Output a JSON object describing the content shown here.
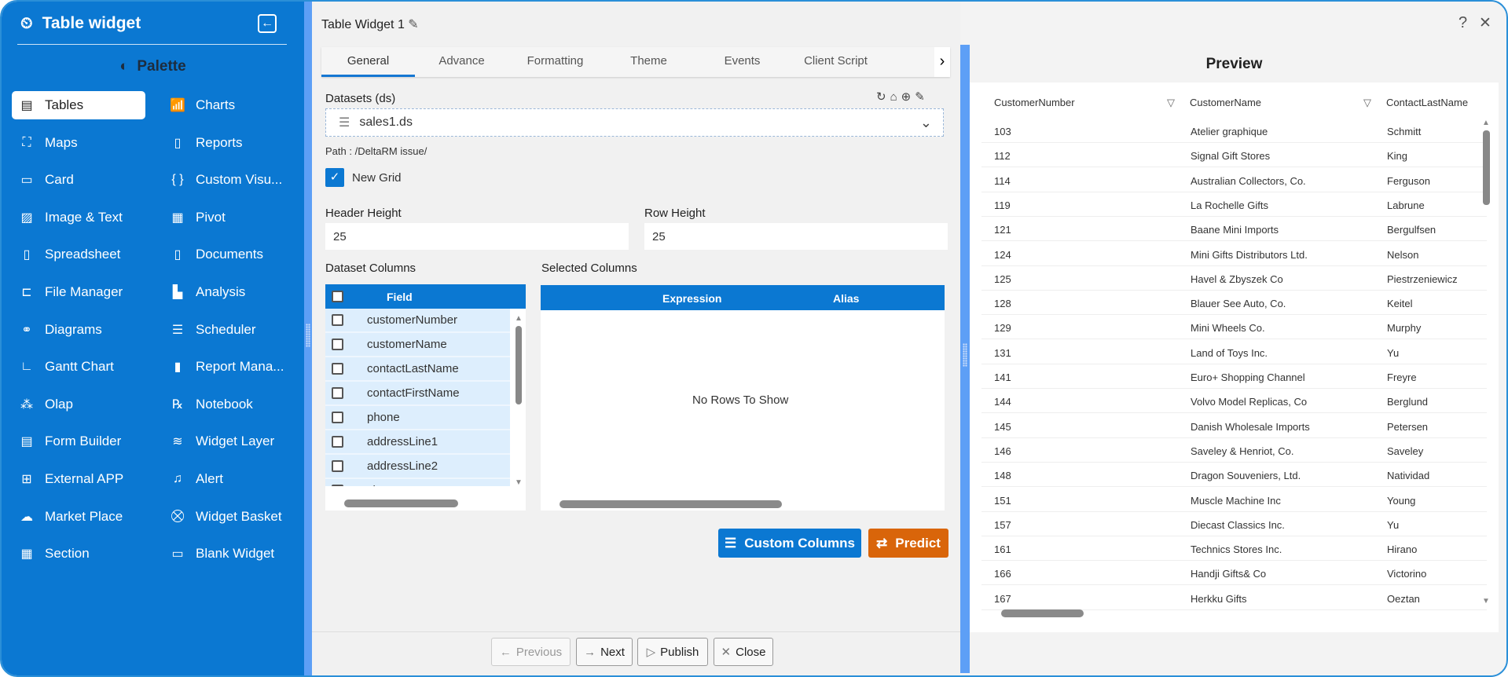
{
  "sidebar": {
    "title": "Table widget",
    "palette": "Palette",
    "items": [
      {
        "label": "Tables",
        "icon": "table-icon",
        "active": true
      },
      {
        "label": "Charts",
        "icon": "chart-icon"
      },
      {
        "label": "Maps",
        "icon": "map-icon"
      },
      {
        "label": "Reports",
        "icon": "report-icon"
      },
      {
        "label": "Card",
        "icon": "card-icon"
      },
      {
        "label": "Custom Visu...",
        "icon": "braces-icon"
      },
      {
        "label": "Image & Text",
        "icon": "image-icon"
      },
      {
        "label": "Pivot",
        "icon": "pivot-icon"
      },
      {
        "label": "Spreadsheet",
        "icon": "excel-file-icon"
      },
      {
        "label": "Documents",
        "icon": "word-file-icon"
      },
      {
        "label": "File Manager",
        "icon": "file-manager-icon"
      },
      {
        "label": "Analysis",
        "icon": "analysis-icon"
      },
      {
        "label": "Diagrams",
        "icon": "diagram-icon"
      },
      {
        "label": "Scheduler",
        "icon": "sliders-icon"
      },
      {
        "label": "Gantt Chart",
        "icon": "gantt-icon"
      },
      {
        "label": "Report Mana...",
        "icon": "report-manager-icon"
      },
      {
        "label": "Olap",
        "icon": "cubes-icon"
      },
      {
        "label": "Notebook",
        "icon": "rx-icon"
      },
      {
        "label": "Form Builder",
        "icon": "form-icon"
      },
      {
        "label": "Widget Layer",
        "icon": "layers-icon"
      },
      {
        "label": "External APP",
        "icon": "apps-icon"
      },
      {
        "label": "Alert",
        "icon": "bell-icon"
      },
      {
        "label": "Market Place",
        "icon": "cloud-upload-icon"
      },
      {
        "label": "Widget Basket",
        "icon": "cart-icon"
      },
      {
        "label": "Section",
        "icon": "grid-icon"
      },
      {
        "label": "Blank Widget",
        "icon": "blank-widget-icon"
      }
    ]
  },
  "main": {
    "title": "Table Widget 1",
    "tabs": [
      "General",
      "Advance",
      "Formatting",
      "Theme",
      "Events",
      "Client Script"
    ],
    "datasets_label": "Datasets (ds)",
    "dataset_value": "sales1.ds",
    "path": "Path : /DeltaRM issue/",
    "new_grid_label": "New Grid",
    "new_grid_checked": true,
    "header_height_label": "Header Height",
    "header_height": "25",
    "row_height_label": "Row Height",
    "row_height": "25",
    "dataset_columns_label": "Dataset Columns",
    "selected_columns_label": "Selected Columns",
    "field_header": "Field",
    "fields": [
      "customerNumber",
      "customerName",
      "contactLastName",
      "contactFirstName",
      "phone",
      "addressLine1",
      "addressLine2",
      "city"
    ],
    "expression_header": "Expression",
    "alias_header": "Alias",
    "no_rows": "No Rows To Show",
    "custom_columns": "Custom Columns",
    "predict": "Predict",
    "footer": {
      "previous": "Previous",
      "next": "Next",
      "publish": "Publish",
      "close": "Close"
    }
  },
  "preview": {
    "title": "Preview",
    "columns": [
      "CustomerNumber",
      "CustomerName",
      "ContactLastName"
    ],
    "rows": [
      [
        "103",
        "Atelier graphique",
        "Schmitt"
      ],
      [
        "112",
        "Signal Gift Stores",
        "King"
      ],
      [
        "114",
        "Australian Collectors, Co.",
        "Ferguson"
      ],
      [
        "119",
        "La Rochelle Gifts",
        "Labrune"
      ],
      [
        "121",
        "Baane Mini Imports",
        "Bergulfsen"
      ],
      [
        "124",
        "Mini Gifts Distributors Ltd.",
        "Nelson"
      ],
      [
        "125",
        "Havel & Zbyszek Co",
        "Piestrzeniewicz"
      ],
      [
        "128",
        "Blauer See Auto, Co.",
        "Keitel"
      ],
      [
        "129",
        "Mini Wheels Co.",
        "Murphy"
      ],
      [
        "131",
        "Land of Toys Inc.",
        "Yu"
      ],
      [
        "141",
        "Euro+ Shopping Channel",
        "Freyre"
      ],
      [
        "144",
        "Volvo Model Replicas, Co",
        "Berglund"
      ],
      [
        "145",
        "Danish Wholesale Imports",
        "Petersen"
      ],
      [
        "146",
        "Saveley & Henriot, Co.",
        "Saveley"
      ],
      [
        "148",
        "Dragon Souveniers, Ltd.",
        "Natividad"
      ],
      [
        "151",
        "Muscle Machine Inc",
        "Young"
      ],
      [
        "157",
        "Diecast Classics Inc.",
        "Yu"
      ],
      [
        "161",
        "Technics Stores Inc.",
        "Hirano"
      ],
      [
        "166",
        "Handji Gifts& Co",
        "Victorino"
      ],
      [
        "167",
        "Herkku Gifts",
        "Oeztan"
      ]
    ]
  },
  "colors": {
    "sidebar": "#0b78d2",
    "accent": "#0b78d2",
    "predict": "#d9650a"
  }
}
